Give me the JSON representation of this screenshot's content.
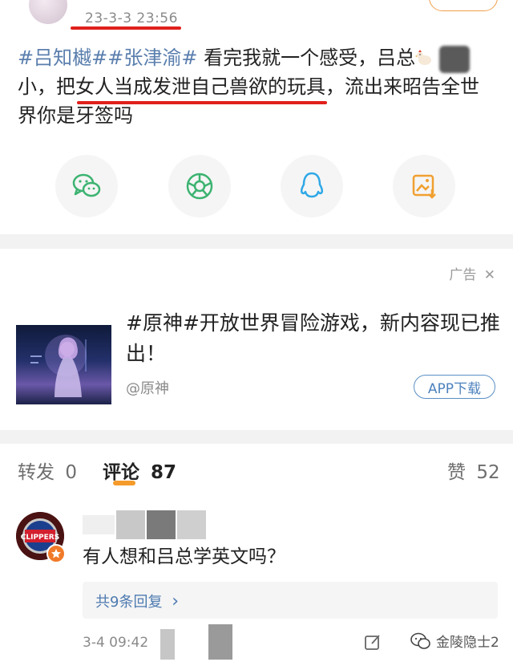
{
  "post": {
    "timestamp": "23-3-3 23:56",
    "text_tags": "#吕知樾##张津渝#",
    "text_line1": " 看完我就一个感受，吕总",
    "text_line2_pre": "小，把",
    "text_line2_hl": "女人当成发泄自己兽欲的玩具",
    "text_line2_post": "，流出来昭告全世",
    "text_line3": "界你是牙签吗",
    "share_icons": [
      "wechat-icon",
      "moments-icon",
      "qq-icon",
      "save-image-icon"
    ]
  },
  "ad": {
    "label": "广告",
    "close_glyph": "✕",
    "title": "#原神#开放世界冒险游戏，新内容现已推出！",
    "source": "@原神",
    "button": "APP下载"
  },
  "tabs": [
    {
      "label": "转发",
      "count": "0"
    },
    {
      "label": "评论",
      "count": "87"
    },
    {
      "label": "赞",
      "count": "52"
    }
  ],
  "comment": {
    "text": "有人想和吕总学英文吗？",
    "replies": "共9条回复",
    "replies_arrow": "›",
    "time": "3-4 09:42",
    "avatar_text": "CLIPPERS"
  },
  "watermark": "金陵隐士2",
  "colors": {
    "accent_orange": "#f49b2b",
    "link_blue": "#4d7ab0",
    "annotation_red": "#e0201c"
  }
}
